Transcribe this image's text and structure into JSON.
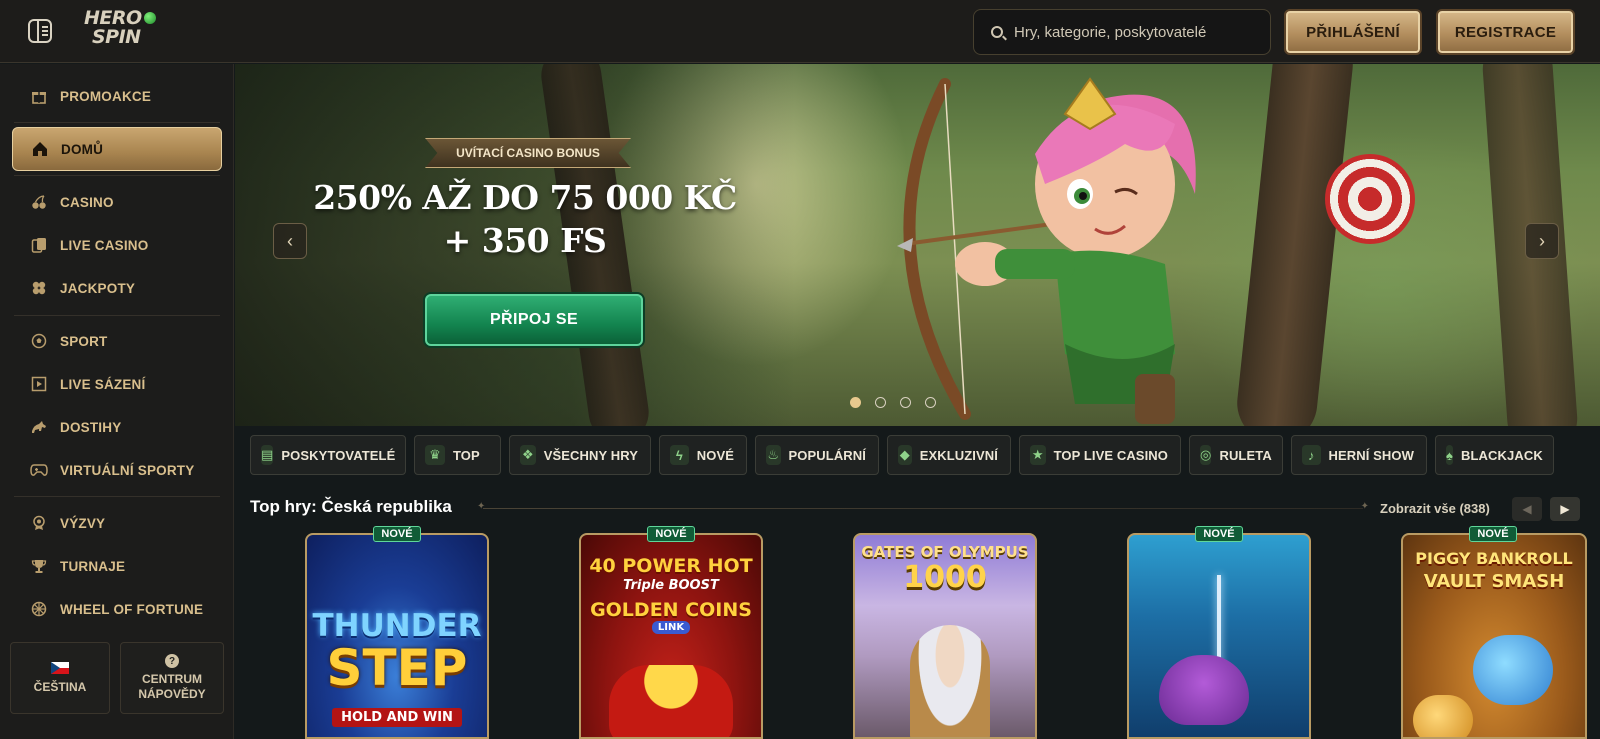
{
  "header": {
    "logo_line1": "HERO",
    "logo_line2": "SPIN",
    "search_placeholder": "Hry, kategorie, poskytovatelé",
    "login_label": "PŘIHLÁŠENÍ",
    "register_label": "REGISTRACE"
  },
  "sidebar": {
    "items": [
      {
        "label": "PROMOAKCE",
        "icon": "gift-icon"
      },
      {
        "label": "DOMŮ",
        "icon": "home-icon",
        "active": true
      },
      {
        "label": "CASINO",
        "icon": "cherries-icon"
      },
      {
        "label": "LIVE CASINO",
        "icon": "cards-icon"
      },
      {
        "label": "JACKPOTY",
        "icon": "clover-icon"
      },
      {
        "label": "SPORT",
        "icon": "soccer-ball-icon"
      },
      {
        "label": "LIVE SÁZENÍ",
        "icon": "live-bet-icon"
      },
      {
        "label": "DOSTIHY",
        "icon": "horse-icon"
      },
      {
        "label": "VIRTUÁLNÍ SPORTY",
        "icon": "gamepad-icon"
      },
      {
        "label": "VÝZVY",
        "icon": "medal-icon"
      },
      {
        "label": "TURNAJE",
        "icon": "trophy-icon"
      },
      {
        "label": "WHEEL OF FORTUNE",
        "icon": "wheel-icon"
      }
    ],
    "language_label": "ČEŠTINA",
    "help_label_1": "CENTRUM",
    "help_label_2": "NÁPOVĚDY"
  },
  "hero": {
    "badge": "UVÍTACÍ CASINO BONUS",
    "title_line1": "250% AŽ DO 75 000 KČ",
    "title_line2": "+ 350 FS",
    "cta_label": "PŘIPOJ SE",
    "prev_arrow": "‹",
    "next_arrow": "›",
    "slides": 4,
    "active_slide": 0
  },
  "categories": [
    {
      "label": "POSKYTOVATELÉ",
      "icon": "providers-icon"
    },
    {
      "label": "TOP",
      "icon": "crown-icon"
    },
    {
      "label": "VŠECHNY HRY",
      "icon": "all-games-icon"
    },
    {
      "label": "NOVÉ",
      "icon": "lightning-icon"
    },
    {
      "label": "POPULÁRNÍ",
      "icon": "fire-icon"
    },
    {
      "label": "EXKLUZIVNÍ",
      "icon": "gem-icon"
    },
    {
      "label": "TOP LIVE CASINO",
      "icon": "star-icon"
    },
    {
      "label": "RULETA",
      "icon": "roulette-icon"
    },
    {
      "label": "HERNÍ SHOW",
      "icon": "microphone-icon"
    },
    {
      "label": "BLACKJACK",
      "icon": "blackjack-icon"
    }
  ],
  "section": {
    "title": "Top hry: Česká republika",
    "show_all": "Zobrazit vše (838)",
    "prev": "◀",
    "next": "▶"
  },
  "games": [
    {
      "name_line1": "THUNDER",
      "name_line2": "STEP",
      "subtitle": "HOLD AND WIN",
      "badge": "NOVÉ"
    },
    {
      "name_line1": "40 POWER HOT",
      "name_line2": "Triple BOOST",
      "subtitle": "GOLDEN COINS",
      "tag": "LINK",
      "badge": "NOVÉ"
    },
    {
      "name_line1": "GATES OF OLYMPUS",
      "name_line2": "1000",
      "badge": ""
    },
    {
      "name_line1": "",
      "name_line2": "",
      "badge": "NOVÉ"
    },
    {
      "name_line1": "PIGGY BANKROLL",
      "name_line2": "VAULT SMASH",
      "badge": "NOVÉ"
    }
  ]
}
